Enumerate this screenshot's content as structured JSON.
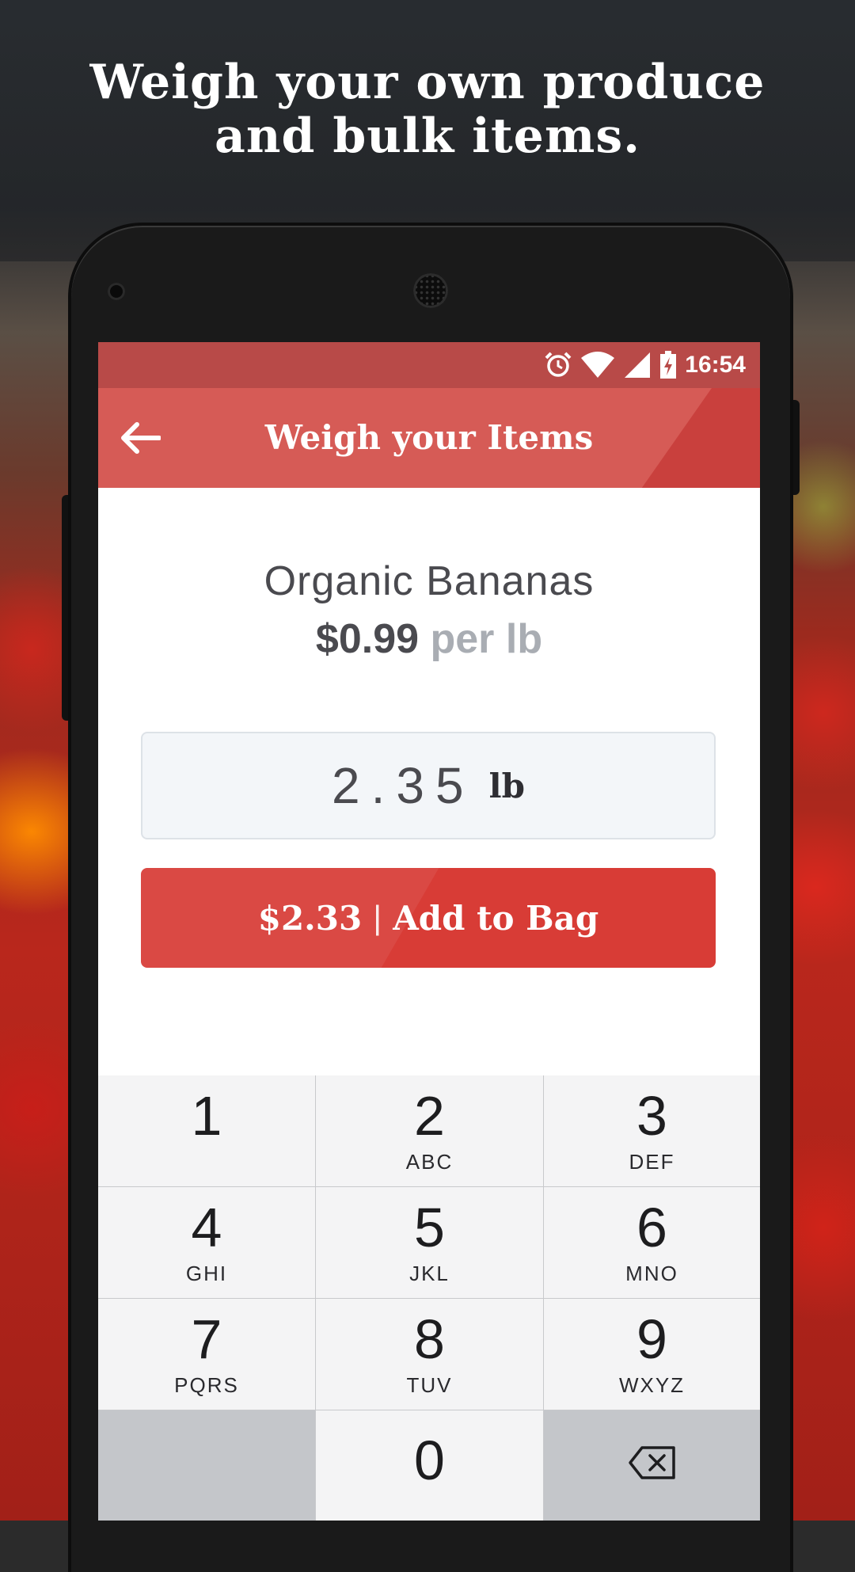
{
  "headline": {
    "line1": "Weigh your own produce",
    "line2": "and bulk items."
  },
  "status_bar": {
    "time": "16:54",
    "icons": [
      "alarm-icon",
      "wifi-icon",
      "signal-icon",
      "battery-charging-icon"
    ]
  },
  "app_bar": {
    "title": "Weigh your Items",
    "back_icon": "back-arrow-icon"
  },
  "product": {
    "name": "Organic Bananas",
    "price": "$0.99",
    "unit": "per lb"
  },
  "weight_input": {
    "value": "2.35",
    "unit": "lb"
  },
  "add_button": {
    "total": "$2.33",
    "separator": "|",
    "label": "Add to Bag"
  },
  "keypad": {
    "keys": [
      {
        "num": "1",
        "letters": ""
      },
      {
        "num": "2",
        "letters": "ABC"
      },
      {
        "num": "3",
        "letters": "DEF"
      },
      {
        "num": "4",
        "letters": "GHI"
      },
      {
        "num": "5",
        "letters": "JKL"
      },
      {
        "num": "6",
        "letters": "MNO"
      },
      {
        "num": "7",
        "letters": "PQRS"
      },
      {
        "num": "8",
        "letters": "TUV"
      },
      {
        "num": "9",
        "letters": "WXYZ"
      },
      {
        "num": "",
        "letters": ""
      },
      {
        "num": "0",
        "letters": ""
      },
      {
        "num": "",
        "letters": "",
        "icon": "backspace-icon"
      }
    ]
  },
  "colors": {
    "app_bar": "#d65b56",
    "status_bar": "#b84a48",
    "accent_button": "#d83c36",
    "text_dark": "#4a4a4f",
    "text_muted": "#a9adb3"
  }
}
